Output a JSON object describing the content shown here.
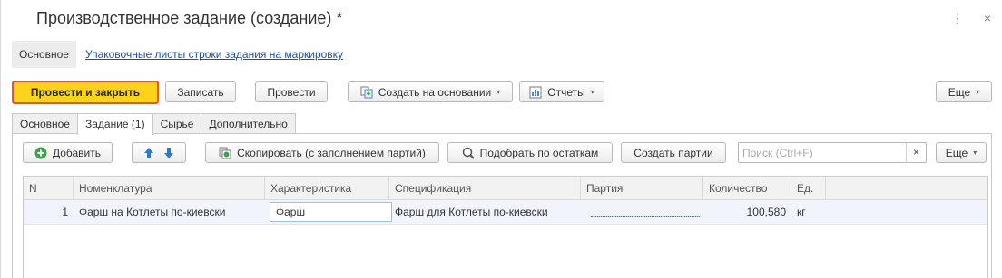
{
  "window": {
    "title": "Производственное задание (создание) *",
    "more_icon": "⋮",
    "close_icon": "×"
  },
  "form_nav": {
    "main": "Основное",
    "packing_link": "Упаковочные листы строки задания на маркировку"
  },
  "toolbar": {
    "post_close": "Провести и закрыть",
    "write": "Записать",
    "post": "Провести",
    "create_based": "Создать на основании",
    "reports": "Отчеты",
    "more": "Еще"
  },
  "tabs": [
    "Основное",
    "Задание (1)",
    "Сырье",
    "Дополнительно"
  ],
  "table_toolbar": {
    "add": "Добавить",
    "copy": "Скопировать (с заполнением партий)",
    "pick": "Подобрать по остаткам",
    "create_batches": "Создать партии",
    "search_placeholder": "Поиск (Ctrl+F)",
    "clear": "×",
    "more": "Еще"
  },
  "table": {
    "columns": [
      "N",
      "Номенклатура",
      "Характеристика",
      "Спецификация",
      "Партия",
      "Количество",
      "Ед."
    ],
    "rows": [
      {
        "n": "1",
        "nomenclature": "Фарш на Котлеты по-киевски",
        "characteristic": "Фарш",
        "specification": "Фарш для Котлеты по-киевски",
        "batch": "",
        "quantity": "100,580",
        "unit": "кг"
      }
    ]
  },
  "colors": {
    "primary_button": "#fcd21a",
    "primary_border": "#e8542b",
    "link": "#1f4e9c",
    "selected_row": "#f1f5fb",
    "add_icon": "#3aa547",
    "arrow_icon": "#2f78d1"
  }
}
